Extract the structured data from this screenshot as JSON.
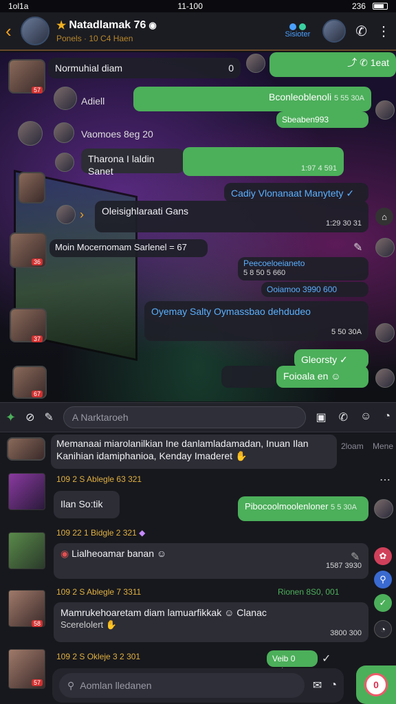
{
  "status": {
    "left": "1ol1a",
    "time": "11-100",
    "right": "236"
  },
  "header": {
    "title": "Natadlamak 76",
    "subtitle": "Ponels · 10 C4 Haen",
    "status_label": "Sisioter",
    "colors": {
      "accent": "#f0a020",
      "online": "#4caf5a",
      "blue": "#4aa0ff"
    },
    "icons": [
      "back-icon",
      "star-icon",
      "verified-icon",
      "phone-icon",
      "more-icon"
    ]
  },
  "chat": {
    "m1": "Normuhial diam",
    "m1_count": "0",
    "m1_out": "1eat",
    "m2_name": "Adiell",
    "m2_out": "Bconleoblenoli",
    "m2_meta": "5 55 30A",
    "m2_reply": "Sbeaben993",
    "m3_name": "Vaomoes 8eg 20",
    "m3_out": "Tharona I laldin Sanet",
    "m3_meta": "1:97 4 591",
    "m4_blue": "Cadiy Vlonanaat Manytety",
    "m5": "Oleisighlaraati Gans",
    "m5_meta": "1:29 30 31",
    "m6": "Moin  Mocernomam  Sarlenel = 67",
    "m7_a": "Peecoeloeianeto",
    "m7_b": "5 8 50 5 660",
    "m7_c": "Ooiamoo 3990 600",
    "m8": "Oyemay  Salty  Oymassbao  dehdudeo",
    "m8_meta": "5 50 30A",
    "m9_out": "Gleorsty",
    "m10_out": "Foioala en"
  },
  "compose": {
    "placeholder": "A Narktaroeh",
    "icons": [
      "shield-icon",
      "pin-icon",
      "image-icon",
      "phone-icon",
      "emoji-icon",
      "clock-icon"
    ]
  },
  "lower": {
    "summary": "Memanaai miarolanilkian Ine danlamladamadan, Inuan Ilan Kanihian idamiphanioa, Kenday Imaderet",
    "summary_side": "2loam",
    "summary_side2": "Mene",
    "r1_meta_a": "109 2 S Ablegle 63 321",
    "r1_bubble": "Ilan So:tik",
    "r1_out": "Pibocoolmoolenloner",
    "r1_out_meta": "5 5 30A",
    "r2_meta": "109 22 1 Bidgle 2 321",
    "r2_bubble": "Lialheoamar banan",
    "r2_time": "1587 3930",
    "r3_meta": "109 2 S Ablegle 7 3311",
    "r3_right": "Rionen 8S0, 001",
    "r3_bubble_a": "Mamrukehoaretam diam lamuarfikkak",
    "r3_bubble_tail": "Clanac",
    "r3_bubble_b": "Scerelolert",
    "r3_time": "3800 300",
    "r4_meta": "109 2 S Okleje 3 2 301",
    "r4_out": "Veib 0 _pin"
  },
  "bottom": {
    "placeholder": "Aomlan lledanen",
    "fab": "0"
  }
}
